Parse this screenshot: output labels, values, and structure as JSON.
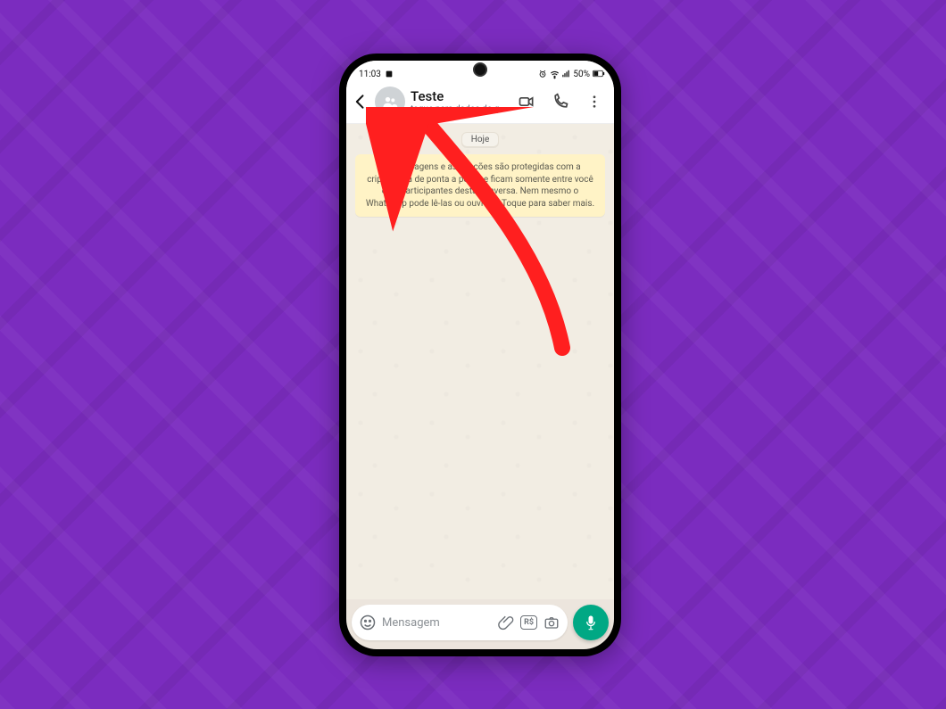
{
  "statusbar": {
    "time": "11:03",
    "battery_text": "50%"
  },
  "header": {
    "group_name": "Teste",
    "subtitle": "toque para dados do gr…"
  },
  "chat": {
    "date_label": "Hoje",
    "encryption_notice": "As mensagens e as ligações são protegidas com a criptografia de ponta a ponta e ficam somente entre você e os participantes desta conversa. Nem mesmo o WhatsApp pode lê-las ou ouvi-las. Toque para saber mais."
  },
  "input": {
    "placeholder": "Mensagem",
    "payment_pill": "R$"
  },
  "colors": {
    "background": "#7b2cbf",
    "mic_button": "#00a884",
    "encryption_box": "#fff3c6",
    "annotation_arrow": "#ff1f1f"
  }
}
